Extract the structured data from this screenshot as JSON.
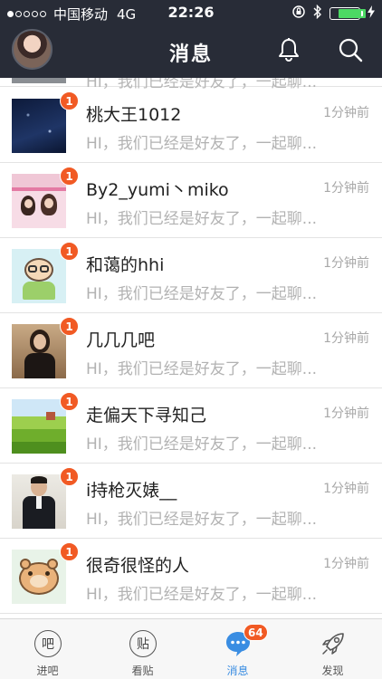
{
  "status_bar": {
    "carrier": "中国移动",
    "network": "4G",
    "time": "22:26"
  },
  "header": {
    "title": "消息"
  },
  "peek_message": "HI，我们已经是好友了，一起聊...",
  "conversations": [
    {
      "name": "桃大王1012",
      "time": "1分钟前",
      "message": "HI，我们已经是好友了，一起聊...",
      "badge": "1"
    },
    {
      "name": "By2_yumi丶miko",
      "time": "1分钟前",
      "message": "HI，我们已经是好友了，一起聊...",
      "badge": "1"
    },
    {
      "name": "和蔼的hhi",
      "time": "1分钟前",
      "message": "HI，我们已经是好友了，一起聊...",
      "badge": "1"
    },
    {
      "name": "几几几吧",
      "time": "1分钟前",
      "message": "HI，我们已经是好友了，一起聊...",
      "badge": "1"
    },
    {
      "name": "走偏天下寻知己",
      "time": "1分钟前",
      "message": "HI，我们已经是好友了，一起聊...",
      "badge": "1"
    },
    {
      "name": "i持枪灭婊__",
      "time": "1分钟前",
      "message": "HI，我们已经是好友了，一起聊...",
      "badge": "1"
    },
    {
      "name": "很奇很怪的人",
      "time": "1分钟前",
      "message": "HI，我们已经是好友了，一起聊...",
      "badge": "1"
    }
  ],
  "tabs": [
    {
      "label": "进吧",
      "glyph": "吧",
      "icon": "ba-circle-icon"
    },
    {
      "label": "看贴",
      "glyph": "贴",
      "icon": "tie-circle-icon"
    },
    {
      "label": "消息",
      "icon": "chat-bubble-icon",
      "badge": "64",
      "active": true
    },
    {
      "label": "发现",
      "icon": "rocket-icon"
    }
  ],
  "colors": {
    "header_bg": "#282c37",
    "badge": "#f15a24",
    "accent": "#3a8de2",
    "battery": "#4cd964"
  }
}
